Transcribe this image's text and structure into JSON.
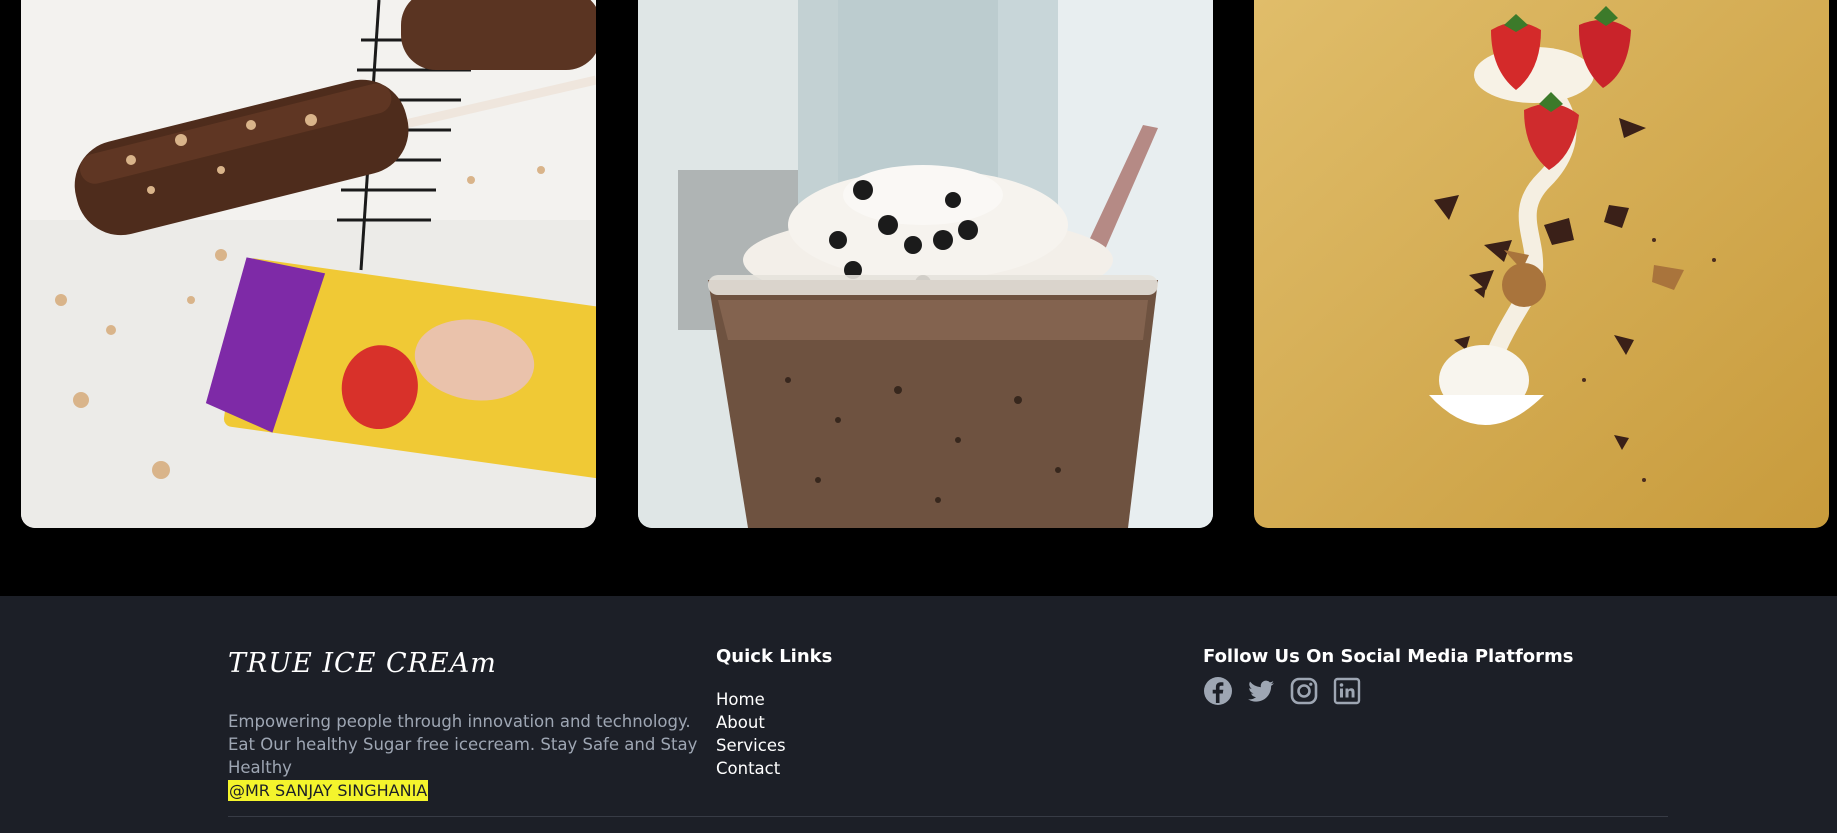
{
  "gallery": {
    "images": [
      {
        "name": "chocolate-nut-ice-cream-bar"
      },
      {
        "name": "iced-chocolate-frappe"
      },
      {
        "name": "strawberry-chocolate-dessert"
      }
    ]
  },
  "footer": {
    "brand": "TRUE ICE CREAm",
    "description": "Empowering people through innovation and technology. Eat Our healthy Sugar free icecream. Stay Safe and Stay Healthy",
    "credit": "@MR SANJAY SINGHANIA",
    "quick_links_title": "Quick Links",
    "quick_links": [
      "Home",
      "About",
      "Services",
      "Contact"
    ],
    "social_title": "Follow Us On Social Media Platforms",
    "social_icons": [
      "facebook-icon",
      "twitter-icon",
      "instagram-icon",
      "linkedin-icon"
    ]
  },
  "colors": {
    "page_bg": "#000000",
    "footer_bg": "#1c1f27",
    "text_muted": "#9ea6b3",
    "highlight": "#f4f42c",
    "icon": "#9ea6b3"
  }
}
